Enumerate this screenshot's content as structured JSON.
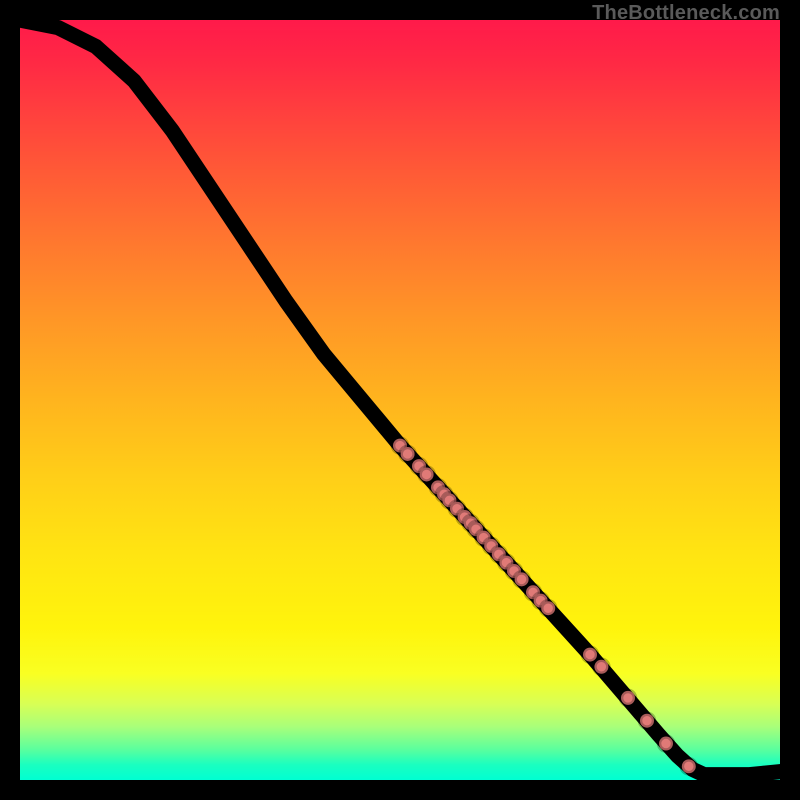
{
  "domain": "Chart",
  "watermark": "TheBottleneck.com",
  "colors": {
    "frame": "#000000",
    "curve": "#000000",
    "dot": "#e07a77",
    "gradient_top": "#ff1a4a",
    "gradient_bottom": "#00ffd2"
  },
  "chart_data": {
    "type": "line",
    "title": "",
    "xlabel": "",
    "ylabel": "",
    "xlim": [
      0,
      100
    ],
    "ylim": [
      0,
      100
    ],
    "curve": [
      {
        "x": 0,
        "y": 100
      },
      {
        "x": 5,
        "y": 99
      },
      {
        "x": 10,
        "y": 96.5
      },
      {
        "x": 15,
        "y": 92
      },
      {
        "x": 20,
        "y": 85.5
      },
      {
        "x": 25,
        "y": 78
      },
      {
        "x": 30,
        "y": 70.5
      },
      {
        "x": 35,
        "y": 63
      },
      {
        "x": 40,
        "y": 56
      },
      {
        "x": 45,
        "y": 50
      },
      {
        "x": 50,
        "y": 44
      },
      {
        "x": 55,
        "y": 38.5
      },
      {
        "x": 60,
        "y": 33
      },
      {
        "x": 65,
        "y": 27.5
      },
      {
        "x": 70,
        "y": 22
      },
      {
        "x": 75,
        "y": 16.5
      },
      {
        "x": 78,
        "y": 13
      },
      {
        "x": 81,
        "y": 9.5
      },
      {
        "x": 84,
        "y": 6
      },
      {
        "x": 86.5,
        "y": 3.2
      },
      {
        "x": 88.5,
        "y": 1.4
      },
      {
        "x": 90,
        "y": 0.7
      },
      {
        "x": 92,
        "y": 0.7
      },
      {
        "x": 94,
        "y": 0.7
      },
      {
        "x": 96,
        "y": 0.7
      },
      {
        "x": 98,
        "y": 0.9
      },
      {
        "x": 100,
        "y": 1.1
      }
    ],
    "points": [
      {
        "x": 50.0,
        "y": 44.0
      },
      {
        "x": 51.0,
        "y": 42.9
      },
      {
        "x": 52.5,
        "y": 41.3
      },
      {
        "x": 53.5,
        "y": 40.2
      },
      {
        "x": 55.0,
        "y": 38.5
      },
      {
        "x": 55.8,
        "y": 37.6
      },
      {
        "x": 56.5,
        "y": 36.8
      },
      {
        "x": 57.5,
        "y": 35.7
      },
      {
        "x": 58.5,
        "y": 34.6
      },
      {
        "x": 59.3,
        "y": 33.8
      },
      {
        "x": 60.0,
        "y": 33.0
      },
      {
        "x": 61.0,
        "y": 31.9
      },
      {
        "x": 62.0,
        "y": 30.8
      },
      {
        "x": 63.0,
        "y": 29.7
      },
      {
        "x": 64.0,
        "y": 28.6
      },
      {
        "x": 65.0,
        "y": 27.5
      },
      {
        "x": 66.0,
        "y": 26.4
      },
      {
        "x": 67.5,
        "y": 24.7
      },
      {
        "x": 68.5,
        "y": 23.6
      },
      {
        "x": 69.5,
        "y": 22.6
      },
      {
        "x": 75.0,
        "y": 16.5
      },
      {
        "x": 76.5,
        "y": 14.9
      },
      {
        "x": 80.0,
        "y": 10.8
      },
      {
        "x": 82.5,
        "y": 7.8
      },
      {
        "x": 85.0,
        "y": 4.8
      },
      {
        "x": 88.0,
        "y": 1.8
      }
    ],
    "point_radius_px": 7
  }
}
